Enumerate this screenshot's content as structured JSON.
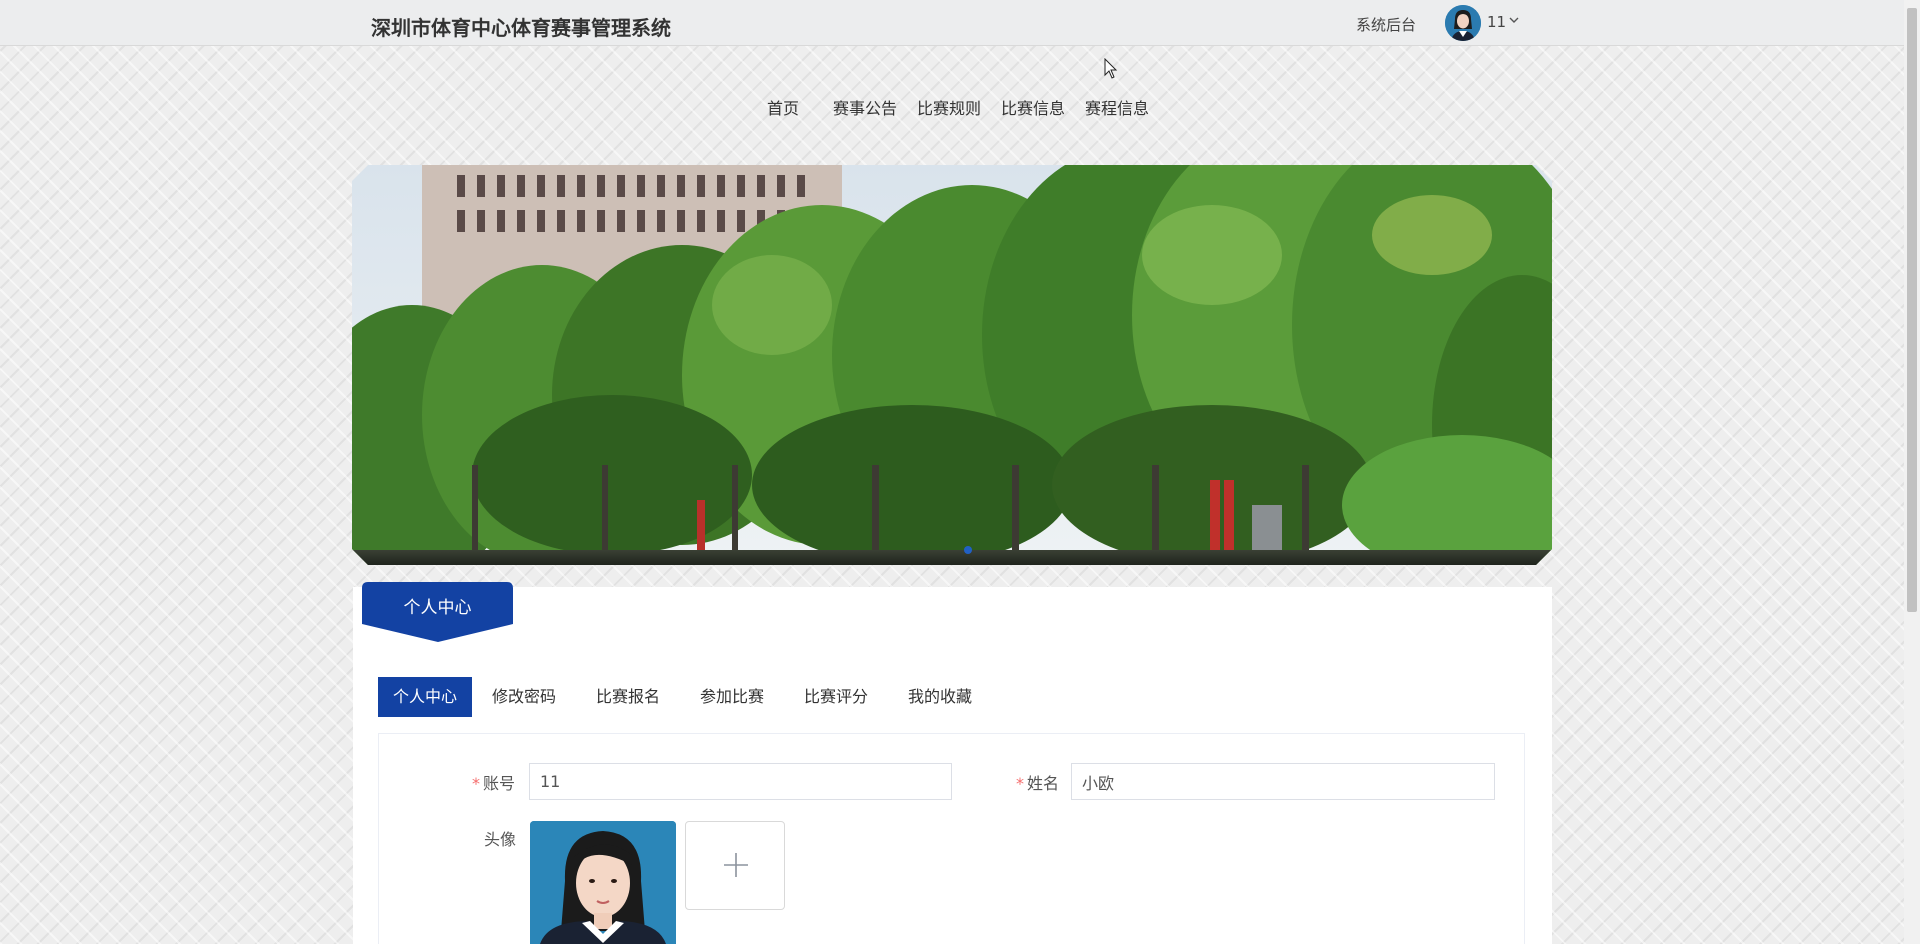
{
  "header": {
    "site_title": "深圳市体育中心体育赛事管理系统",
    "admin_link": "系统后台",
    "user_name": "11",
    "caret_icon": "chevron-down-icon"
  },
  "nav": {
    "items": [
      {
        "label": "首页"
      },
      {
        "label": "赛事公告"
      },
      {
        "label": "比赛规则"
      },
      {
        "label": "比赛信息"
      },
      {
        "label": "赛程信息"
      }
    ]
  },
  "banner": {
    "slide_count_visible_indicator": 1
  },
  "section": {
    "badge_label": "个人中心"
  },
  "tabs": [
    {
      "label": "个人中心",
      "active": true
    },
    {
      "label": "修改密码",
      "active": false
    },
    {
      "label": "比赛报名",
      "active": false
    },
    {
      "label": "参加比赛",
      "active": false
    },
    {
      "label": "比赛评分",
      "active": false
    },
    {
      "label": "我的收藏",
      "active": false
    }
  ],
  "form": {
    "account_label": "账号",
    "account_value": "11",
    "name_label": "姓名",
    "name_value": "小欧",
    "avatar_label": "头像",
    "required_mark": "*",
    "upload_icon": "plus-icon"
  },
  "colors": {
    "accent": "#1342a3",
    "required": "#f56c6c"
  }
}
